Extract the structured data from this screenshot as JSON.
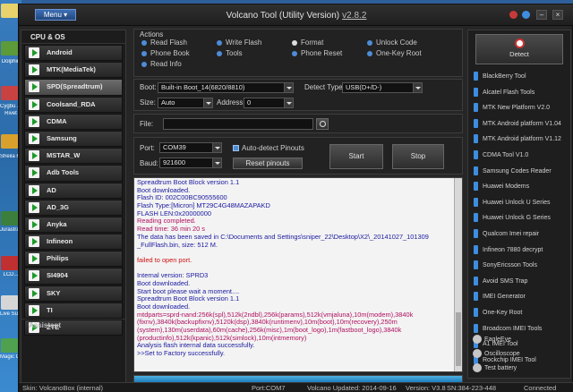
{
  "window": {
    "title": "Volcano Tool (Utility Version)",
    "version": "v2.8.2",
    "menu_label": "Menu ▾"
  },
  "desktop": {
    "labels": [
      "Dolphin",
      "Cygbu ...",
      "Rivet",
      "Sheila Fusion",
      "Jurastra N...",
      "LCD...",
      "Live Sub...",
      "Magic Conver..."
    ]
  },
  "left_panel": {
    "header": "CPU & OS",
    "items": [
      "Android",
      "MTK(MediaTek)",
      "SPD(Spreadtrum)",
      "Coolsand_RDA",
      "CDMA",
      "Samsung",
      "MSTAR_W",
      "Adb Tools",
      "AD",
      "AD_3G",
      "Anyka",
      "Infineon",
      "Philips",
      "SI4904",
      "SKY",
      "TI",
      "ZTE"
    ],
    "selected_index": 2,
    "assistant_label": "Assistant"
  },
  "actions": {
    "title": "Actions",
    "items": [
      "Read Flash",
      "Write Flash",
      "Format",
      "Unlock Code",
      "Phone Book",
      "Tools",
      "Phone Reset",
      "One-Key Root",
      "Read Info"
    ]
  },
  "boot": {
    "boot_label": "Boot:",
    "boot_value": "Built-in Boot_14(6820/8810)",
    "detect_type_label": "Detect Type:",
    "detect_type_value": "USB(D+/D-)",
    "size_label": "Size:",
    "size_value": "Auto",
    "address_label": "Address",
    "address_value": "0"
  },
  "file": {
    "label": "File:",
    "value": ""
  },
  "port": {
    "port_label": "Port:",
    "port_value": "COM39",
    "baud_label": "Baud:",
    "baud_value": "921600",
    "auto_detect_label": "Auto-detect Pinouts",
    "reset_label": "Reset pinouts",
    "start_label": "Start",
    "stop_label": "Stop"
  },
  "log": {
    "lines": [
      {
        "text": "Spreadtrum Boot Block version 1.1",
        "color": "#1a1aa0"
      },
      {
        "text": "Boot downloaded.",
        "color": "#1a1aa0"
      },
      {
        "text": "Flash ID: 002C00BC90555600",
        "color": "#1a1aa0"
      },
      {
        "text": "Flash Type:[Micron] MT29C4G48MAZAPAKD",
        "color": "#1a1aa0"
      },
      {
        "text": "FLASH LEN:0x20000000",
        "color": "#1a1aa0"
      },
      {
        "text": "Reading completed.",
        "color": "#b01060"
      },
      {
        "text": "Read time: 36 min 20 s",
        "color": "#b01060"
      },
      {
        "text": "The data has been saved in C:\\Documents and Settings\\sniper_22\\Desktop\\X2\\_20141027_101309",
        "color": "#1a1aa0"
      },
      {
        "text": "_FullFlash.bin, size: 512 M.",
        "color": "#1a1aa0"
      },
      {
        "text": "",
        "color": "#1a1aa0"
      },
      {
        "text": "failed to open port.",
        "color": "#d01010"
      },
      {
        "text": "",
        "color": "#1a1aa0"
      },
      {
        "text": "Internal version: SPRD3",
        "color": "#1a1aa0"
      },
      {
        "text": "Boot downloaded.",
        "color": "#1a1aa0"
      },
      {
        "text": "Start boot please wait a moment....",
        "color": "#1a1aa0"
      },
      {
        "text": "Spreadtrum Boot Block version 1.1",
        "color": "#1a1aa0"
      },
      {
        "text": "Boot downloaded.",
        "color": "#1a1aa0"
      },
      {
        "text": "mtdparts=sprd-nand:256k(spl),512k(2ndbl),256k(params),512k(vmjaluna),10m(modem),3840k",
        "color": "#b01060"
      },
      {
        "text": "(fixnv),3840k(backupfixnv),5120k(dsp),3840k(runtimenv),10m(boot),10m(recovery),250m",
        "color": "#b01060"
      },
      {
        "text": "(system),130m(userdata),60m(cache),256k(misc),1m(boot_logo),1m(fastboot_logo),3840k",
        "color": "#b01060"
      },
      {
        "text": "(productinfo),512k(kpanic),512k(simlock),10m(intmemory)",
        "color": "#b01060"
      },
      {
        "text": "Analysis flash internal data successfully.",
        "color": "#1a1aa0"
      },
      {
        "text": ">>Set to Factory successfully.",
        "color": "#1a1aa0"
      }
    ]
  },
  "progress": {
    "value": 1.0
  },
  "right_panel": {
    "detect_label": "Detect",
    "items": [
      "BlackBerry Tool",
      "Alcatel Flash Tools",
      "MTK New Platform V2.0",
      "MTK Android platform V1.04",
      "MTK Android platform V1.12",
      "CDMA Tool V1.0",
      "Samsung Codes Reader",
      "Huawei Modems",
      "Huawei Unlock U Series",
      "Huawei Unlock G Series",
      "Qualcom Imei repair",
      "Infineon 7880 decrypt",
      "SonyEricsson Tools",
      "Avoid SMS Trap",
      "IMEI Generator",
      "One-Key Root",
      "Broadcom IMEI Tools",
      "A1 IMEI Tool",
      "Rockchip IMEI Tool"
    ],
    "bottom_items": [
      "EagleEye",
      "Oscilloscope",
      "Test battery"
    ]
  },
  "statusbar": {
    "skin": "Skin: VolcanoBox (internal)",
    "port": "Port:COM7",
    "updated": "Volcano Updated: 2014-09-16",
    "version": "Version: V3.8",
    "sn": "SN:384-223-448",
    "connected": "Connected"
  },
  "colors": {
    "accent": "#3d8de0",
    "start_icon": "#1e9a2a"
  }
}
